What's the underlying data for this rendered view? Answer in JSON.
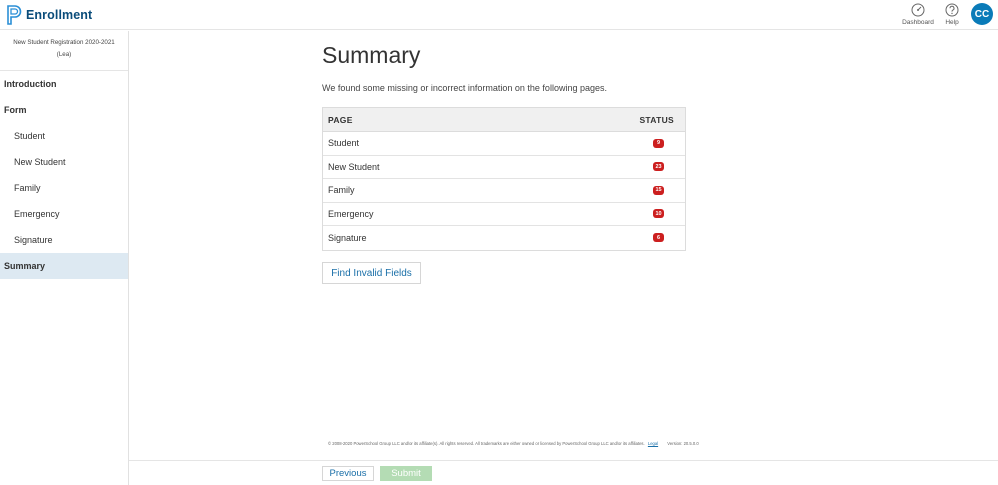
{
  "app": {
    "title": "Enrollment"
  },
  "topnav": {
    "dashboard_label": "Dashboard",
    "help_label": "Help",
    "avatar_initials": "CC"
  },
  "sidebar": {
    "form_title_line1": "New Student Registration 2020-2021",
    "form_title_line2": "(Lea)",
    "items": [
      {
        "label": "Introduction"
      },
      {
        "label": "Form"
      },
      {
        "label": "Student"
      },
      {
        "label": "New Student"
      },
      {
        "label": "Family"
      },
      {
        "label": "Emergency"
      },
      {
        "label": "Signature"
      },
      {
        "label": "Summary"
      }
    ]
  },
  "main": {
    "title": "Summary",
    "intro": "We found some missing or incorrect information on the following pages.",
    "table": {
      "col_page": "PAGE",
      "col_status": "STATUS",
      "rows": [
        {
          "page": "Student",
          "count": "9"
        },
        {
          "page": "New Student",
          "count": "23"
        },
        {
          "page": "Family",
          "count": "15"
        },
        {
          "page": "Emergency",
          "count": "10"
        },
        {
          "page": "Signature",
          "count": "6"
        }
      ]
    },
    "find_button": "Find Invalid Fields"
  },
  "footer": {
    "copyright": "© 2008-2020 PowerSchool Group LLC and/or its affiliate(s). All rights reserved. All trademarks are either owned or licensed by PowerSchool Group LLC and/or its affiliates.",
    "legal": "Legal",
    "version": "Version: 20.5.0.0"
  },
  "bottombar": {
    "previous": "Previous",
    "submit": "Submit"
  },
  "colors": {
    "brand": "#0a4c7a",
    "accent": "#0a7bb8",
    "link": "#1a6fa8",
    "badge": "#cc1f1f",
    "active_bg": "#dde9f2",
    "submit_disabled": "#b4dcb4"
  },
  "icons": {
    "logo": "powerschool-p-logo",
    "dashboard": "dashboard-gauge-icon",
    "help": "help-question-icon"
  }
}
